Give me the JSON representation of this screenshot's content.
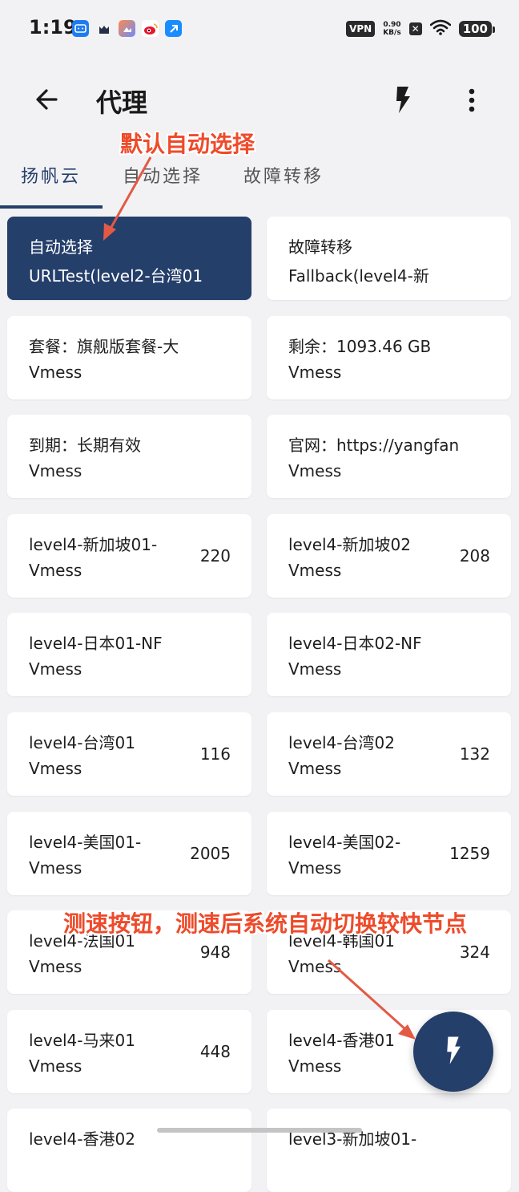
{
  "status_bar": {
    "time": "1:19",
    "vpn": "VPN",
    "net_speed_value": "0.90",
    "net_speed_unit": "KB/s",
    "battery": "100"
  },
  "app_bar": {
    "title": "代理"
  },
  "tabs": [
    {
      "label": "扬帆云",
      "active": true
    },
    {
      "label": "自动选择",
      "active": false
    },
    {
      "label": "故障转移",
      "active": false
    }
  ],
  "annotations": {
    "top": "默认自动选择",
    "bottom": "测速按钮，测速后系统自动切换较快节点"
  },
  "proxies": [
    {
      "name": "自动选择",
      "type": "URLTest(level2-台湾01",
      "delay": "",
      "selected": true
    },
    {
      "name": "故障转移",
      "type": "Fallback(level4-新",
      "delay": ""
    },
    {
      "name": "套餐：旗舰版套餐-大",
      "type": "Vmess",
      "delay": ""
    },
    {
      "name": "剩余：1093.46 GB",
      "type": "Vmess",
      "delay": ""
    },
    {
      "name": "到期：长期有效",
      "type": "Vmess",
      "delay": ""
    },
    {
      "name": "官网：https://yangfan",
      "type": "Vmess",
      "delay": ""
    },
    {
      "name": "level4-新加坡01-",
      "type": "Vmess",
      "delay": "220"
    },
    {
      "name": "level4-新加坡02",
      "type": "Vmess",
      "delay": "208"
    },
    {
      "name": "level4-日本01-NF",
      "type": "Vmess",
      "delay": ""
    },
    {
      "name": "level4-日本02-NF",
      "type": "Vmess",
      "delay": ""
    },
    {
      "name": "level4-台湾01",
      "type": "Vmess",
      "delay": "116"
    },
    {
      "name": "level4-台湾02",
      "type": "Vmess",
      "delay": "132"
    },
    {
      "name": "level4-美国01-",
      "type": "Vmess",
      "delay": "2005"
    },
    {
      "name": "level4-美国02-",
      "type": "Vmess",
      "delay": "1259"
    },
    {
      "name": "level4-法国01",
      "type": "Vmess",
      "delay": "948"
    },
    {
      "name": "level4-韩国01",
      "type": "Vmess",
      "delay": "324"
    },
    {
      "name": "level4-马来01",
      "type": "Vmess",
      "delay": "448"
    },
    {
      "name": "level4-香港01",
      "type": "Vmess",
      "delay": ""
    },
    {
      "name": "level4-香港02",
      "type": "",
      "delay": ""
    },
    {
      "name": "level3-新加坡01-",
      "type": "",
      "delay": ""
    }
  ],
  "colors": {
    "accent": "#253f6b",
    "annotation": "#ee4b2b",
    "background": "#f2f2f4"
  }
}
